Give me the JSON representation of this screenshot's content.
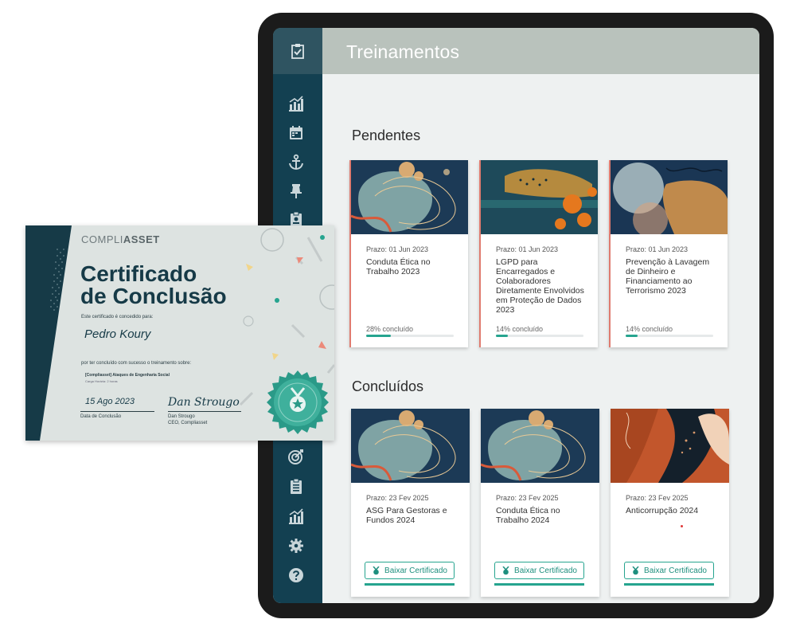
{
  "app": {
    "title": "Treinamentos",
    "sidebar": {
      "top_icon": "checklist-icon",
      "items": [
        {
          "icon": "bar-chart-icon"
        },
        {
          "icon": "calendar-icon"
        },
        {
          "icon": "anchor-icon"
        },
        {
          "icon": "pin-icon"
        },
        {
          "icon": "id-badge-icon"
        },
        {
          "icon": "target-icon"
        },
        {
          "icon": "clipboard-icon"
        },
        {
          "icon": "bar-chart-icon"
        },
        {
          "icon": "gear-icon"
        },
        {
          "icon": "help-icon"
        }
      ]
    },
    "pendentes": {
      "title": "Pendentes",
      "cards": [
        {
          "prazo": "Prazo: 01 Jun 2023",
          "title": "Conduta Ética no Trabalho 2023",
          "progress_label": "28% concluído",
          "progress": 28
        },
        {
          "prazo": "Prazo: 01 Jun 2023",
          "title": "LGPD para Encarregados e Colaboradores Diretamente Envolvidos em Proteção de Dados 2023",
          "progress_label": "14% concluído",
          "progress": 14
        },
        {
          "prazo": "Prazo: 01 Jun 2023",
          "title": "Prevenção à Lavagem de Dinheiro e Financiamento ao Terrorismo 2023",
          "progress_label": "14% concluído",
          "progress": 14
        }
      ]
    },
    "concluidos": {
      "title": "Concluídos",
      "cards": [
        {
          "prazo": "Prazo: 23 Fev 2025",
          "title": "ASG Para Gestoras e Fundos 2024",
          "button": "Baixar Certificado"
        },
        {
          "prazo": "Prazo: 23 Fev 2025",
          "title": "Conduta Ética no Trabalho 2024",
          "button": "Baixar Certificado"
        },
        {
          "prazo": "Prazo: 23 Fev 2025",
          "title": "Anticorrupção 2024",
          "button": "Baixar Certificado"
        }
      ]
    }
  },
  "certificate": {
    "logo_light": "COMPLI",
    "logo_bold": "ASSET",
    "title_line1": "Certificado",
    "title_line2": "de Conclusão",
    "granted_to": "Este certificado é concedido para:",
    "recipient": "Pedro Koury",
    "completed_text": "por ter concluído com sucesso o treinamento sobre:",
    "course": "[Compliasset] Ataques de Engenharia Social",
    "hours": "Carga Horária: 2 horas",
    "date": "15 Ago 2023",
    "date_label": "Data de Conclusão",
    "signature": "Dan Strougo",
    "signer": "Dan Strougo",
    "signer_role": "CEO, Compliasset",
    "seal_icon": "star-medal-icon"
  },
  "colors": {
    "sidebar": "#134051",
    "appbar": "#b9c2bc",
    "accent": "#26a48f",
    "pending_border": "#e07b6f"
  }
}
